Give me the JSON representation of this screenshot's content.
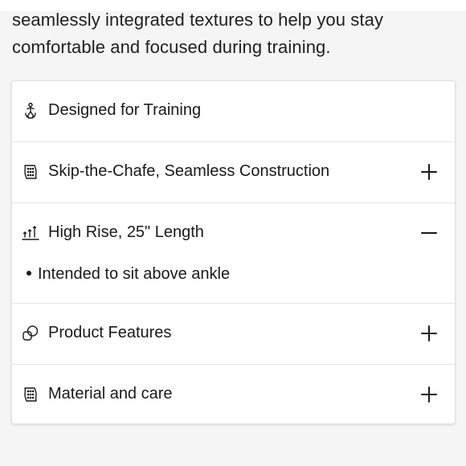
{
  "intro": {
    "line1": "seamlessly integrated textures to help you stay",
    "line2": "comfortable and focused during training."
  },
  "accordion": {
    "items": [
      {
        "label": "Designed for Training",
        "icon": "athlete-icon",
        "expandable": false
      },
      {
        "label": "Skip-the-Chafe, Seamless Construction",
        "icon": "fabric-icon",
        "state": "collapsed"
      },
      {
        "label": "High Rise, 25\" Length",
        "icon": "rise-length-icon",
        "state": "expanded",
        "details": [
          "Intended to sit above ankle"
        ]
      },
      {
        "label": "Product Features",
        "icon": "features-icon",
        "state": "collapsed"
      },
      {
        "label": "Material and care",
        "icon": "fabric-icon",
        "state": "collapsed"
      }
    ]
  },
  "colors": {
    "text": "#1a1a1a",
    "border": "#e4e4e4",
    "card_background": "#ffffff",
    "page_background": "#f5f5f5"
  }
}
